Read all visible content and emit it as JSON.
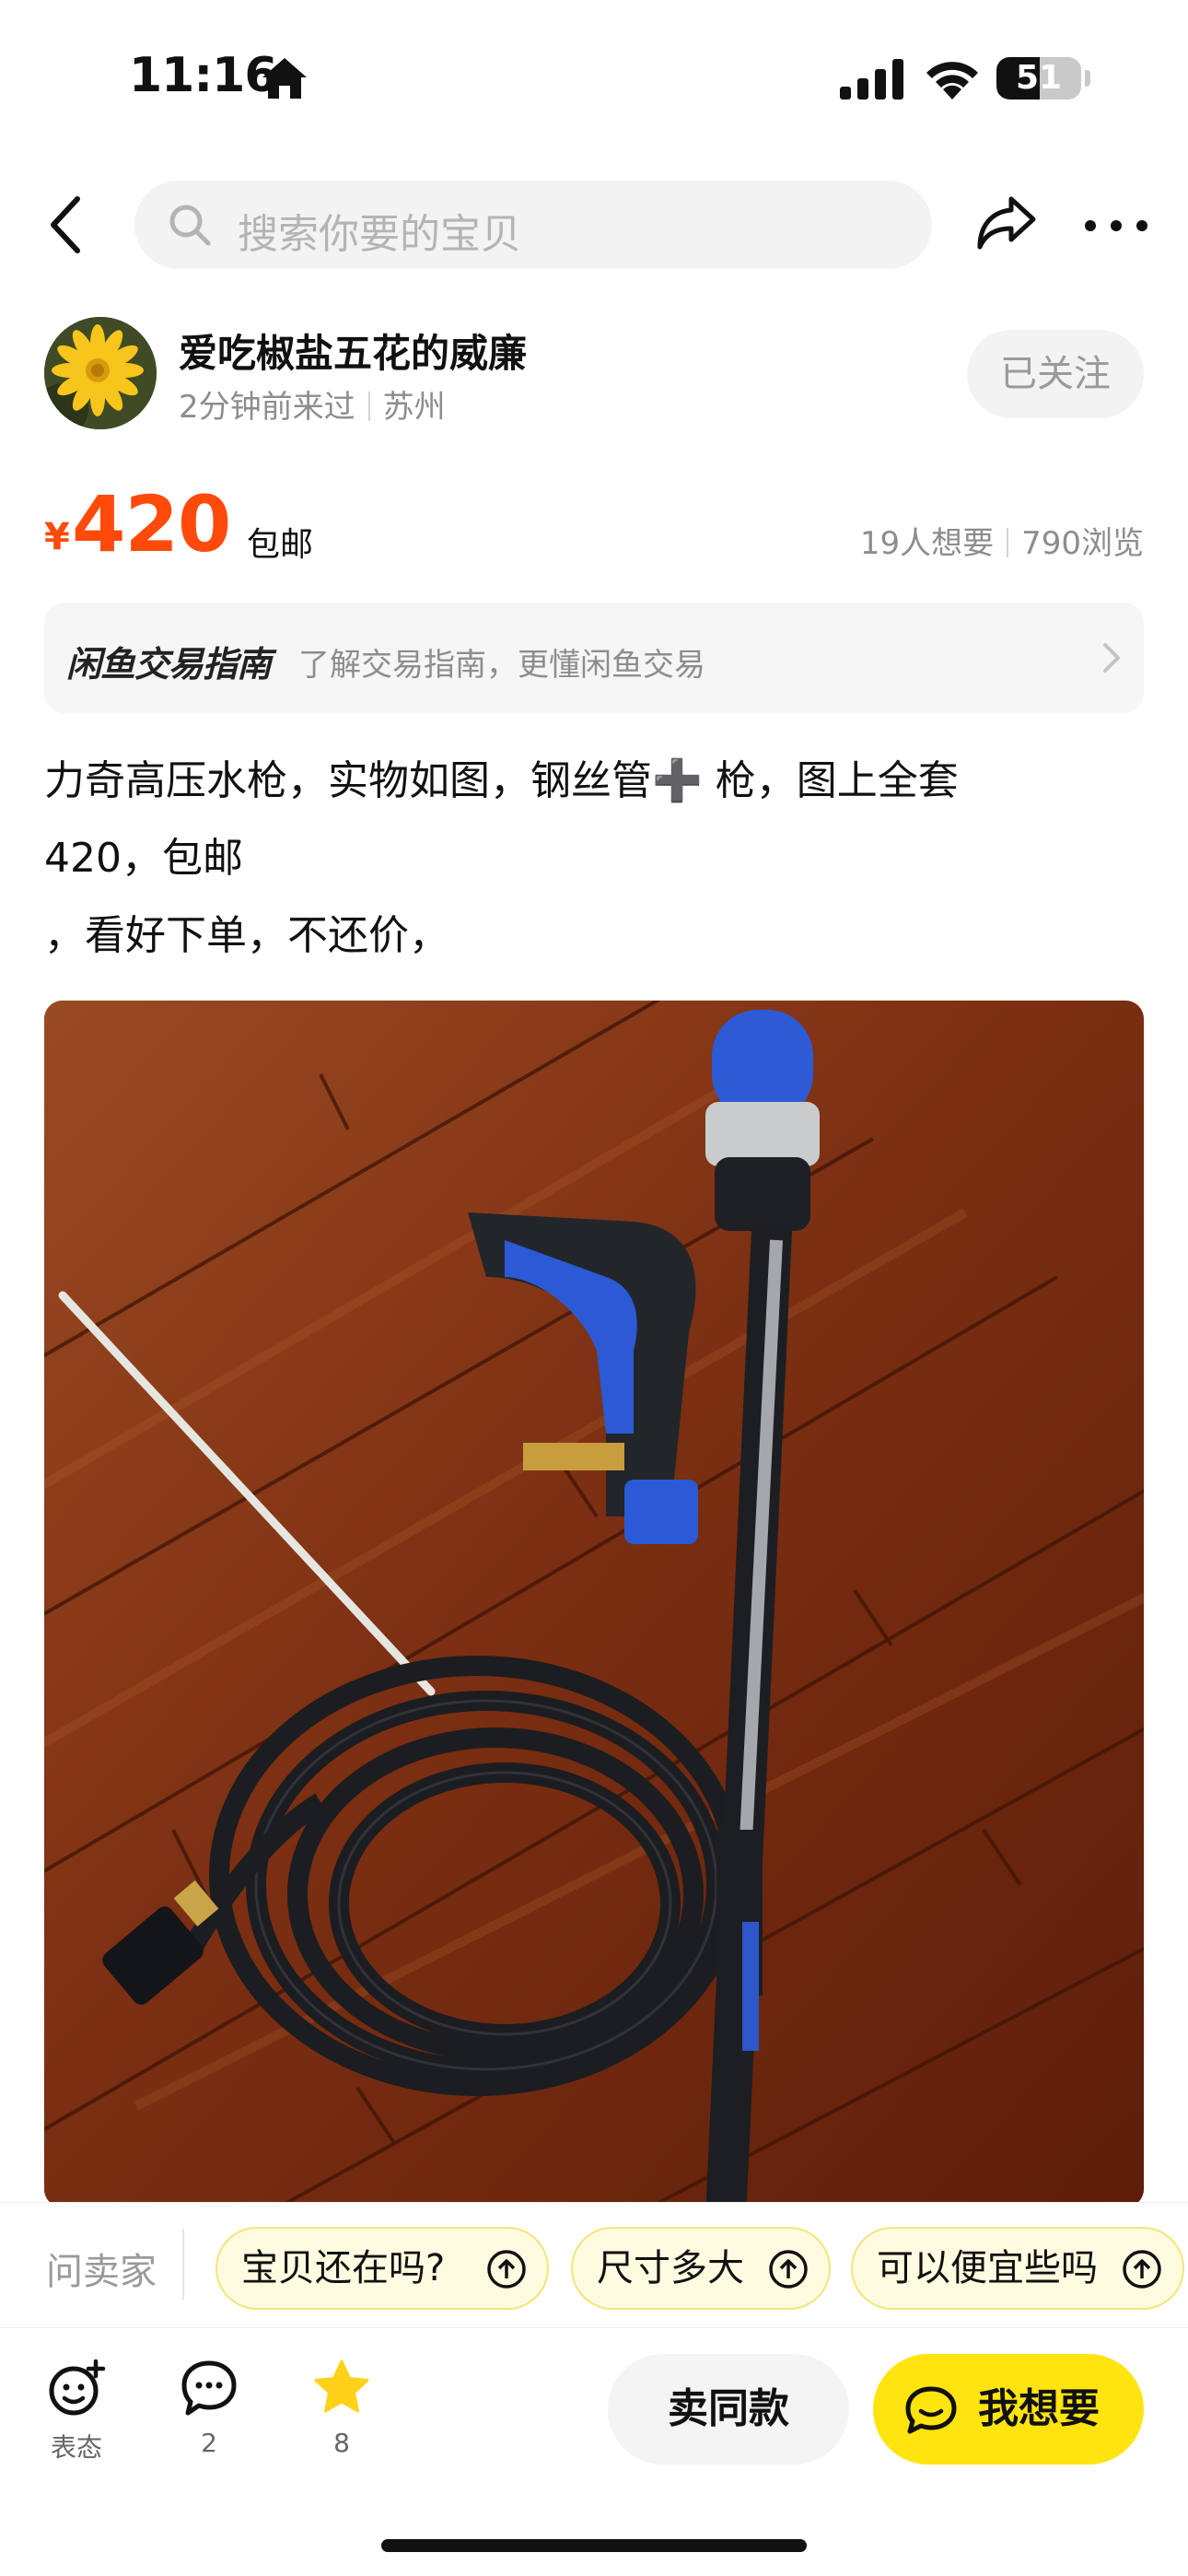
{
  "status_bar": {
    "time": "11:16",
    "battery": "51",
    "battery_level": 0.51
  },
  "nav": {
    "search_placeholder": "搜索你要的宝贝",
    "icons": [
      "back-icon",
      "search-icon",
      "share-icon",
      "more-icon"
    ]
  },
  "seller": {
    "name": "爱吃椒盐五花的威廉",
    "last_seen": "2分钟前来过",
    "location": "苏州",
    "follow_label": "已关注"
  },
  "price": {
    "currency": "¥",
    "value": "420",
    "shipping": "包邮",
    "wants": "19人想要",
    "views": "790浏览"
  },
  "guide": {
    "title": "闲鱼交易指南",
    "description": "了解交易指南，更懂闲鱼交易"
  },
  "description": {
    "lines": [
      "力奇高压水枪，实物如图，钢丝管➕ 枪，图上全套",
      "420，包邮",
      "，看好下单，不还价，"
    ]
  },
  "ask_bar": {
    "label": "问卖家",
    "chips": [
      "宝贝还在吗?",
      "尺寸多大",
      "可以便宜些吗"
    ]
  },
  "bottom_bar": {
    "react_label": "表态",
    "comments": "2",
    "favorites": "8",
    "same_item_label": "卖同款",
    "want_label": "我想要"
  },
  "colors": {
    "price": "#ff4a0a",
    "accent_yellow": "#ffe40f",
    "chip_bg": "#fffbe0"
  }
}
